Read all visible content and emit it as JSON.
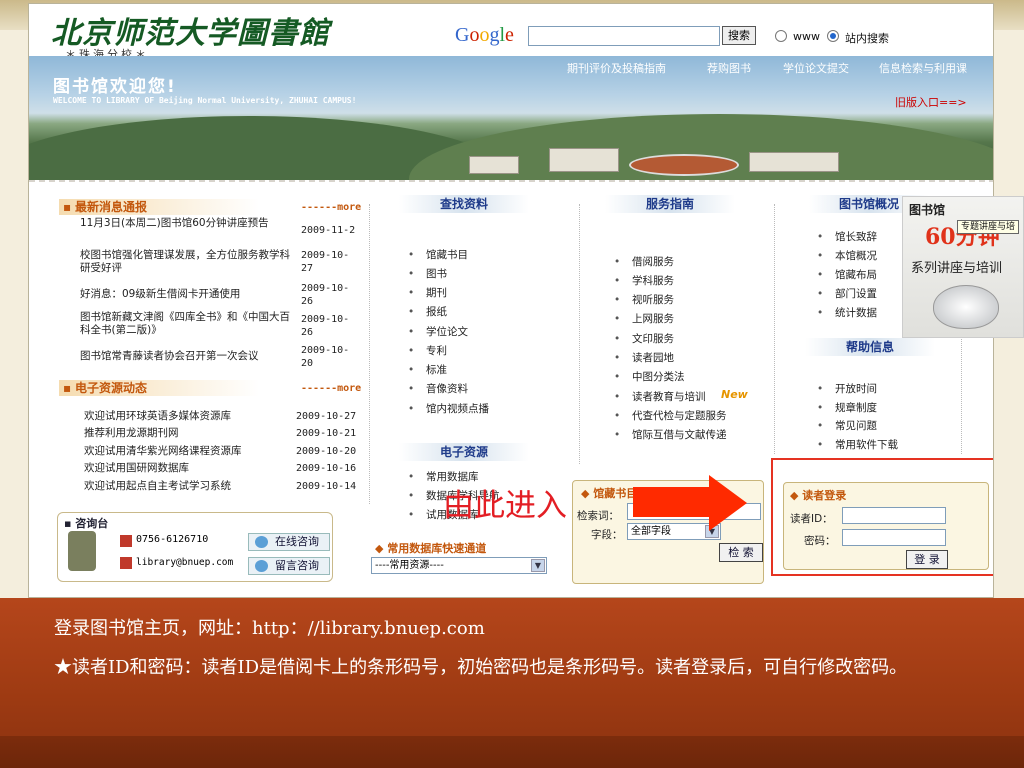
{
  "header": {
    "logo_text": "北京师范大学圖書館",
    "logo_sub": "＊珠海分校＊",
    "google_logo": "Google",
    "search_button": "搜索",
    "radio_www": "www",
    "radio_site": "站内搜索"
  },
  "banner": {
    "welcome": "图书馆欢迎您!",
    "welcome_en": "WELCOME TO LIBRARY OF Beijing Normal University, ZHUHAI CAMPUS!",
    "nav": [
      "期刊评价及投稿指南",
      "荐购图书",
      "学位论文提交",
      "信息检索与利用课"
    ],
    "old_version": "旧版入口==>"
  },
  "columns": {
    "find": "查找资料",
    "service": "服务指南",
    "about": "图书馆概况",
    "help": "帮助信息",
    "eres": "电子资源"
  },
  "news": {
    "title": "最新消息通报",
    "more": "------more",
    "items": [
      {
        "text": "11月3日(本周二)图书馆60分钟讲座预告",
        "date": "2009-11-2"
      },
      {
        "text": "校图书馆强化管理谋发展，全方位服务教学科研受好评",
        "date": "2009-10-27"
      },
      {
        "text": "好消息：09级新生借阅卡开通使用",
        "date": "2009-10-26"
      },
      {
        "text": "图书馆新藏文津阁《四库全书》和《中国大百科全书(第二版)》",
        "date": "2009-10-26"
      },
      {
        "text": "图书馆常青藤读者协会召开第一次会议",
        "date": "2009-10-20"
      }
    ]
  },
  "edynamics": {
    "title": "电子资源动态",
    "more": "------more",
    "items": [
      {
        "text": "欢迎试用环球英语多媒体资源库",
        "date": "2009-10-27"
      },
      {
        "text": "推荐利用龙源期刊网",
        "date": "2009-10-21"
      },
      {
        "text": "欢迎试用清华紫光网络课程资源库",
        "date": "2009-10-20"
      },
      {
        "text": "欢迎试用国研网数据库",
        "date": "2009-10-16"
      },
      {
        "text": "欢迎试用起点自主考试学习系统",
        "date": "2009-10-14"
      }
    ]
  },
  "find_items": [
    "馆藏书目",
    "图书",
    "期刊",
    "报纸",
    "学位论文",
    "专利",
    "标准",
    "音像资料",
    "馆内视频点播"
  ],
  "service_items": [
    "借阅服务",
    "学科服务",
    "视听服务",
    "上网服务",
    "文印服务",
    "读者园地",
    "中图分类法",
    "读者教育与培训",
    "代查代检与定题服务",
    "馆际互借与文献传递"
  ],
  "new_badge": "New",
  "about_items": [
    "馆长致辞",
    "本馆概况",
    "馆藏布局",
    "部门设置",
    "统计数据"
  ],
  "help_items": [
    "开放时间",
    "规章制度",
    "常见问题",
    "常用软件下载"
  ],
  "eres_items": [
    "常用数据库",
    "数据库学科导航",
    "试用数据库"
  ],
  "consult": {
    "title": "咨询台",
    "phone": "0756-6126710",
    "email": "library@bnuep.com",
    "online": "在线咨询",
    "message": "留言咨询"
  },
  "fastlane": {
    "title": "常用数据库快速通道",
    "select_value": "----常用资源----"
  },
  "catalog": {
    "title": "馆藏书目",
    "keyword_label": "检索词：",
    "field_label": "字段：",
    "field_value": "全部字段",
    "search_button": "检 索"
  },
  "login": {
    "title": "读者登录",
    "id_label": "读者ID：",
    "pwd_label": "密码：",
    "button": "登 录"
  },
  "annotation": {
    "enter_text": "由此进入"
  },
  "popup": {
    "title": "图书馆",
    "big": "60分钟",
    "tooltip": "专题讲座与培",
    "subtitle": "系列讲座与培训"
  },
  "caption": {
    "line1": "登录图书馆主页，网址：http：//library.bnuep.com",
    "line2": "★读者ID和密码：读者ID是借阅卡上的条形码号，初始密码也是条形码号。读者登录后，可自行修改密码。"
  }
}
